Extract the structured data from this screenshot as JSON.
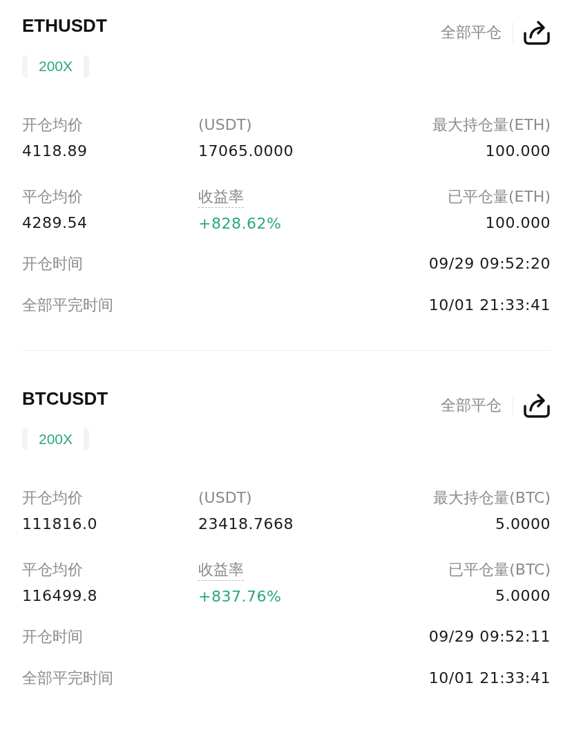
{
  "positions": [
    {
      "symbol": "ETHUSDT",
      "leverage": "200X",
      "close_all": "全部平仓",
      "stats": [
        [
          {
            "label": "开仓均价",
            "value": "4118.89",
            "kind": "plain"
          },
          {
            "label": "(USDT)",
            "value": "17065.0000",
            "kind": "plain"
          },
          {
            "label": "最大持仓量(ETH)",
            "value": "100.000",
            "kind": "plain"
          }
        ],
        [
          {
            "label": "平仓均价",
            "value": "4289.54",
            "kind": "plain"
          },
          {
            "label": "收益率",
            "value": "+828.62%",
            "kind": "rate"
          },
          {
            "label": "已平仓量(ETH)",
            "value": "100.000",
            "kind": "plain"
          }
        ]
      ],
      "times": [
        {
          "label": "开仓时间",
          "value": "09/29 09:52:20"
        },
        {
          "label": "全部平完时间",
          "value": "10/01 21:33:41"
        }
      ]
    },
    {
      "symbol": "BTCUSDT",
      "leverage": "200X",
      "close_all": "全部平仓",
      "stats": [
        [
          {
            "label": "开仓均价",
            "value": "111816.0",
            "kind": "plain"
          },
          {
            "label": "(USDT)",
            "value": "23418.7668",
            "kind": "plain"
          },
          {
            "label": "最大持仓量(BTC)",
            "value": "5.0000",
            "kind": "plain"
          }
        ],
        [
          {
            "label": "平仓均价",
            "value": "116499.8",
            "kind": "plain"
          },
          {
            "label": "收益率",
            "value": "+837.76%",
            "kind": "rate"
          },
          {
            "label": "已平仓量(BTC)",
            "value": "5.0000",
            "kind": "plain"
          }
        ]
      ],
      "times": [
        {
          "label": "开仓时间",
          "value": "09/29 09:52:11"
        },
        {
          "label": "全部平完时间",
          "value": "10/01 21:33:41"
        }
      ]
    }
  ]
}
